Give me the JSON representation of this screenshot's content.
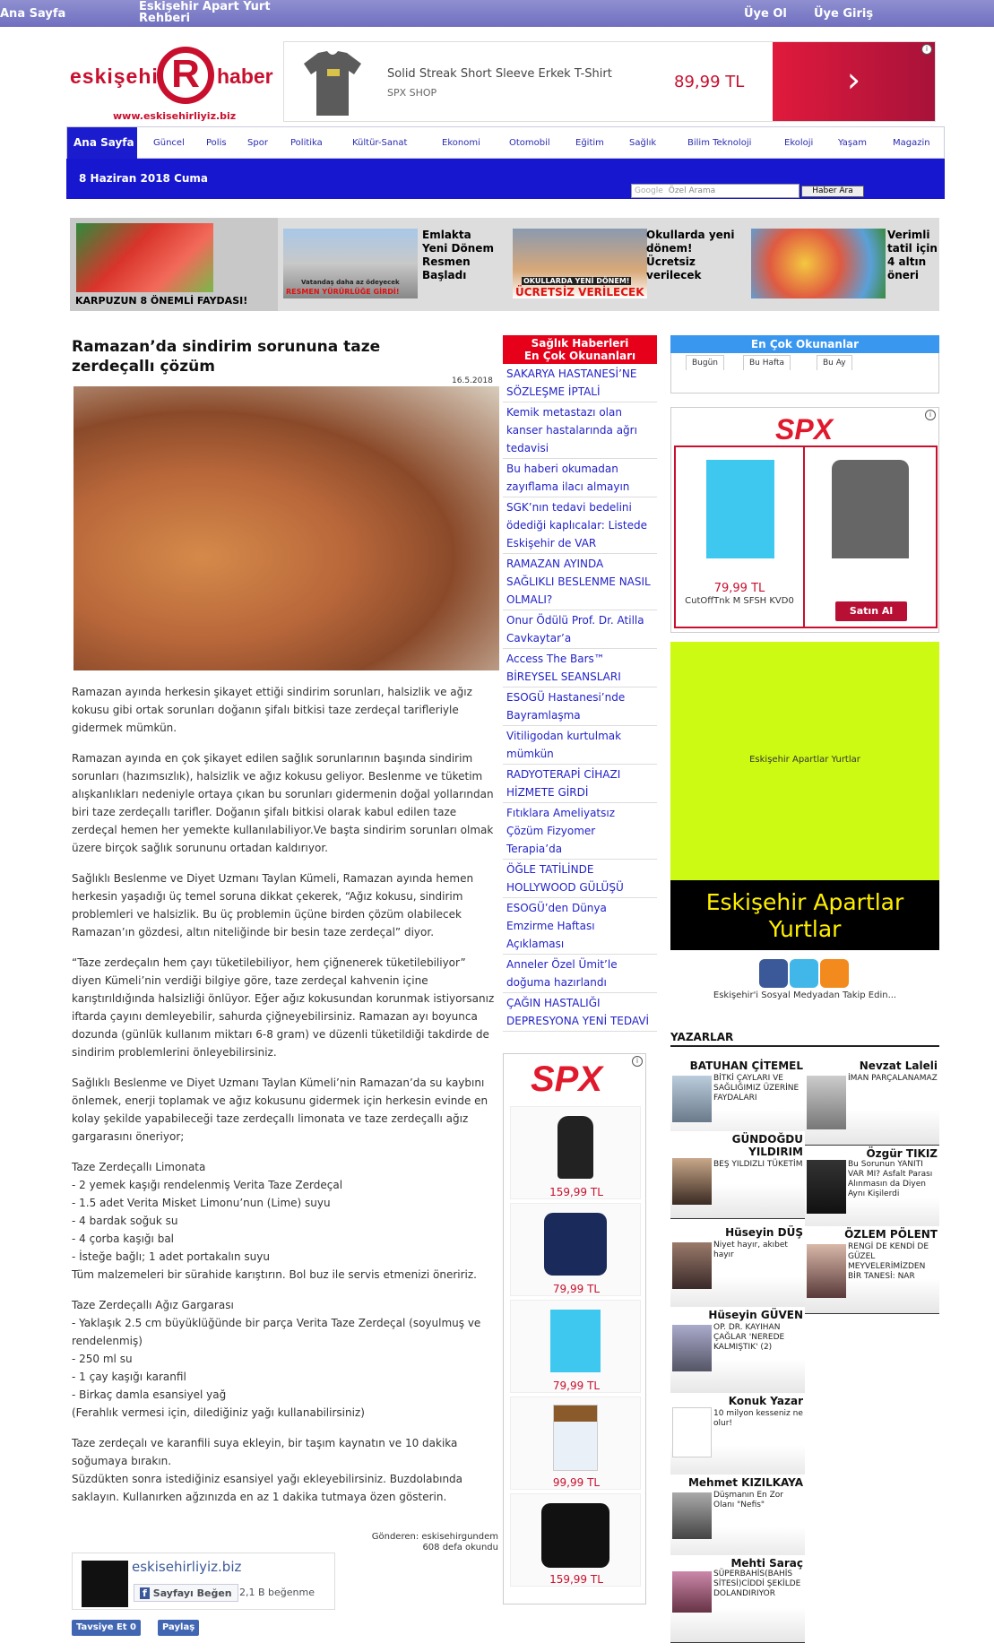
{
  "topbar": {
    "home": "Ana Sayfa",
    "guide": "Eskişehir Apart Yurt Rehberi",
    "register": "Üye Ol",
    "login": "Üye Giriş"
  },
  "logo": {
    "part1": "eskişehi",
    "letter": "R",
    "part2": "haber",
    "url": "www.eskisehirliyiz.biz"
  },
  "top_ad": {
    "product": "Solid Streak Short Sleeve Erkek T-Shirt",
    "shop": "SPX SHOP",
    "price": "89,99 TL"
  },
  "nav": {
    "home": "Ana Sayfa",
    "items": [
      "Güncel",
      "Polis",
      "Spor",
      "Politika",
      "Kültür-Sanat",
      "Ekonomi",
      "Otomobil",
      "Eğitim",
      "Sağlık",
      "Bilim Teknoloji",
      "Ekoloji",
      "Yaşam",
      "Magazin"
    ]
  },
  "band": {
    "date": "8 Haziran 2018 Cuma",
    "search_placeholder": "Özel Arama",
    "google": "Google",
    "search_button": "Haber Ara"
  },
  "slider": {
    "first_caption": "KARPUZUN 8 ÖNEMLİ FAYDASI!",
    "items": [
      "Emlakta Yeni Dönem Resmen Başladı",
      "Okullarda yeni dönem! Ücretsiz verilecek",
      "Verimli tatil için 4 altın öneri"
    ],
    "thumb_texts": [
      "Vatandaş daha az ödeyecek",
      "RESMEN YÜRÜRLÜĞE GİRDİ!",
      "OKULLARDA YENİ DÖNEM!",
      "ÜCRETSİZ VERİLECEK"
    ]
  },
  "article": {
    "title": "Ramazan’da sindirim sorununa taze zerdeçallı çözüm",
    "date": "16.5.2018",
    "paragraphs": [
      "Ramazan ayında herkesin şikayet ettiği sindirim sorunları, halsizlik ve ağız kokusu gibi ortak sorunları doğanın şifalı bitkisi taze zerdeçal tarifleriyle gidermek mümkün.",
      "Ramazan ayında en çok şikayet edilen sağlık sorunlarının başında sindirim sorunları (hazımsızlık), halsizlik ve ağız kokusu geliyor. Beslenme ve tüketim alışkanlıkları nedeniyle ortaya çıkan bu sorunları gidermenin doğal yollarından biri taze zerdeçallı tarifler. Doğanın şifalı bitkisi olarak kabul edilen taze zerdeçal hemen her yemekte kullanılabiliyor.Ve başta sindirim sorunları olmak üzere birçok sağlık sorununu ortadan kaldırıyor.",
      "Sağlıklı Beslenme ve Diyet Uzmanı Taylan Kümeli, Ramazan ayında hemen herkesin yaşadığı üç temel soruna dikkat çekerek, “Ağız kokusu, sindirim problemleri ve halsizlik. Bu üç problemin üçüne birden çözüm olabilecek Ramazan’ın gözdesi, altın niteliğinde bir besin taze zerdeçal” diyor.",
      "“Taze zerdeçalın hem çayı tüketilebiliyor, hem çiğnenerek tüketilebiliyor” diyen Kümeli’nin verdiği bilgiye göre, taze zerdeçal kahvenin içine karıştırıldığında halsizliği önlüyor. Eğer ağız kokusundan korunmak istiyorsanız iftarda çayını demleyebilir, sahurda çiğneyebilirsiniz. Ramazan ayı boyunca dozunda (günlük kullanım miktarı 6-8 gram) ve düzenli tüketildiği takdirde de sindirim problemlerini önleyebilirsiniz.",
      "Sağlıklı Beslenme ve Diyet Uzmanı Taylan Kümeli’nin Ramazan’da su kaybını önlemek, enerji toplamak ve ağız kokusunu gidermek için herkesin evinde en kolay şekilde yapabileceği taze zerdeçallı limonata ve taze zerdeçallı ağız gargarasını öneriyor;",
      "Taze Zerdeçallı Limonata\n- 2 yemek kaşığı rendelenmiş Verita Taze Zerdeçal\n- 1.5 adet Verita Misket Limonu’nun (Lime) suyu\n- 4 bardak soğuk su\n- 4 çorba kaşığı bal\n- İsteğe bağlı; 1 adet portakalın suyu\nTüm malzemeleri bir sürahide karıştırın. Bol buz ile servis etmenizi öneririz.",
      "Taze Zerdeçallı Ağız Gargarası\n- Yaklaşık 2.5 cm büyüklüğünde bir parça Verita Taze Zerdeçal (soyulmuş ve rendelenmiş)\n- 250 ml su\n- 1 çay kaşığı karanfil\n- Birkaç damla esansiyel yağ\n(Ferahlık vermesi için, dilediğiniz yağı kullanabilirsiniz)",
      "Taze zerdeçalı ve karanfili suya ekleyin, bir taşım kaynatın ve 10 dakika soğumaya bırakın.\nSüzdükten sonra istediğiniz esansiyel yağı ekleyebilirsiniz. Buzdolabında saklayın. Kullanırken ağzınızda en az 1 dakika tutmaya özen gösterin."
    ],
    "sender": "Gönderen: eskisehirgundem",
    "reads": "608 defa okundu"
  },
  "facebook": {
    "page": "eskisehirliyiz.biz",
    "like": "Sayfayı Beğen",
    "count": "2,1 B beğenme",
    "recommend": "Tavsiye Et 0",
    "share": "Paylaş"
  },
  "health": {
    "header1": "Sağlık Haberleri",
    "header2": "En Çok Okunanları",
    "items": [
      "SAKARYA HASTANESİ’NE SÖZLEŞME İPTALİ",
      "Kemik metastazı olan kanser hastalarında ağrı tedavisi",
      "Bu haberi okumadan zayıflama ilacı almayın",
      "SGK’nın tedavi bedelini ödediği kaplıcalar: Listede Eskişehir de VAR",
      "RAMAZAN AYINDA SAĞLIKLI BESLENME NASIL OLMALI?",
      "Onur Ödülü Prof. Dr. Atilla Cavkaytar’a",
      "Access The Bars™ BİREYSEL SEANSLARI",
      "ESOGÜ Hastanesi’nde Bayramlaşma",
      "Vitiligodan kurtulmak mümkün",
      "RADYOTERAPİ CİHAZI HİZMETE GİRDİ",
      "Fıtıklara Ameliyatsız Çözüm Fizyomer Terapia’da",
      "ÖĞLE TATİLİNDE HOLLYWOOD GÜLÜŞÜ",
      "ESOGÜ’den Dünya Emzirme Haftası Açıklaması",
      "Anneler Özel Ümit’le doğuma hazırlandı",
      "ÇAĞIN HASTALIĞI DEPRESYONA YENİ TEDAVİ"
    ]
  },
  "mid_ad": {
    "logo": "SPX",
    "prices": [
      "159,99 TL",
      "79,99 TL",
      "79,99 TL",
      "99,99 TL",
      "159,99 TL"
    ]
  },
  "most_read": {
    "header": "En Çok Okunanlar",
    "tabs": [
      "Bugün",
      "Bu Hafta",
      "Bu Ay"
    ]
  },
  "spx_ad": {
    "logo": "SPX",
    "price": "79,99 TL",
    "product": "CutOffTnk M SFSH KVD0",
    "buy": "Satın Al"
  },
  "green_ad": {
    "label": "Eskişehir Apartlar Yurtlar",
    "title": "Eskişehir Apartlar Yurtlar"
  },
  "social": {
    "caption": "Eskişehir'i Sosyal Medyadan Takip Edin..."
  },
  "writers": {
    "header": "YAZARLAR",
    "items": [
      {
        "name": "BATUHAN ÇİTEMEL",
        "desc": "BİTKİ ÇAYLARI VE SAĞLIĞIMIZ ÜZERİNE FAYDALARI"
      },
      {
        "name": "Nevzat Laleli",
        "desc": "İMAN PARÇALANAMAZ"
      },
      {
        "name": "GÜNDOĞDU YILDIRIM",
        "desc": "BEŞ YILDIZLI TÜKETİM"
      },
      {
        "name": "Özgür TIKIZ",
        "desc": "Bu Sorunun YANITI VAR MI? Asfalt Parası Alınmasın da Diyen Aynı Kişilerdi"
      },
      {
        "name": "Hüseyin DÜŞ",
        "desc": "Niyet hayır, akıbet hayır"
      },
      {
        "name": "ÖZLEM PÖLENT",
        "desc": "RENGİ DE KENDİ DE GÜZEL MEYVELERİMİZDEN BİR TANESİ: NAR"
      },
      {
        "name": "Hüseyin GÜVEN",
        "desc": "OP. DR. KAYIHAN ÇAĞLAR 'NEREDE KALMIŞTIK' (2)"
      },
      {
        "name": "Konuk Yazar",
        "desc": "10 milyon kesseniz ne olur!"
      },
      {
        "name": "Mehmet KIZILKAYA",
        "desc": "Düşmanın En Zor Olanı \"Nefis\""
      },
      {
        "name": "Mehti Saraç",
        "desc": "SÜPERBAHİS(BAHİS SİTESİ)CİDDİ ŞEKİLDE DOLANDIRIYOR"
      }
    ]
  }
}
